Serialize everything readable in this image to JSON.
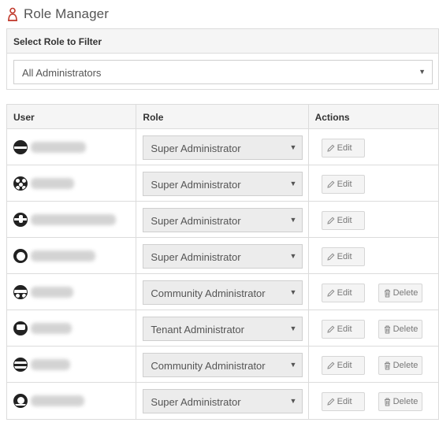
{
  "header": {
    "title": "Role Manager",
    "icon": "user-shield-icon"
  },
  "filter": {
    "panel_title": "Select Role to Filter",
    "selected": "All Administrators"
  },
  "table": {
    "columns": [
      "User",
      "Role",
      "Actions"
    ],
    "edit_label": "Edit",
    "delete_label": "Delete",
    "rows": [
      {
        "role": "Super Administrator",
        "has_delete": false
      },
      {
        "role": "Super Administrator",
        "has_delete": false
      },
      {
        "role": "Super Administrator",
        "has_delete": false
      },
      {
        "role": "Super Administrator",
        "has_delete": false
      },
      {
        "role": "Community Administrator",
        "has_delete": true
      },
      {
        "role": "Tenant Administrator",
        "has_delete": true
      },
      {
        "role": "Community Administrator",
        "has_delete": true
      },
      {
        "role": "Super Administrator",
        "has_delete": true
      }
    ]
  },
  "colors": {
    "accent_icon": "#c0392b",
    "header_bg": "#f5f5f5",
    "border": "#dcdcdc"
  }
}
